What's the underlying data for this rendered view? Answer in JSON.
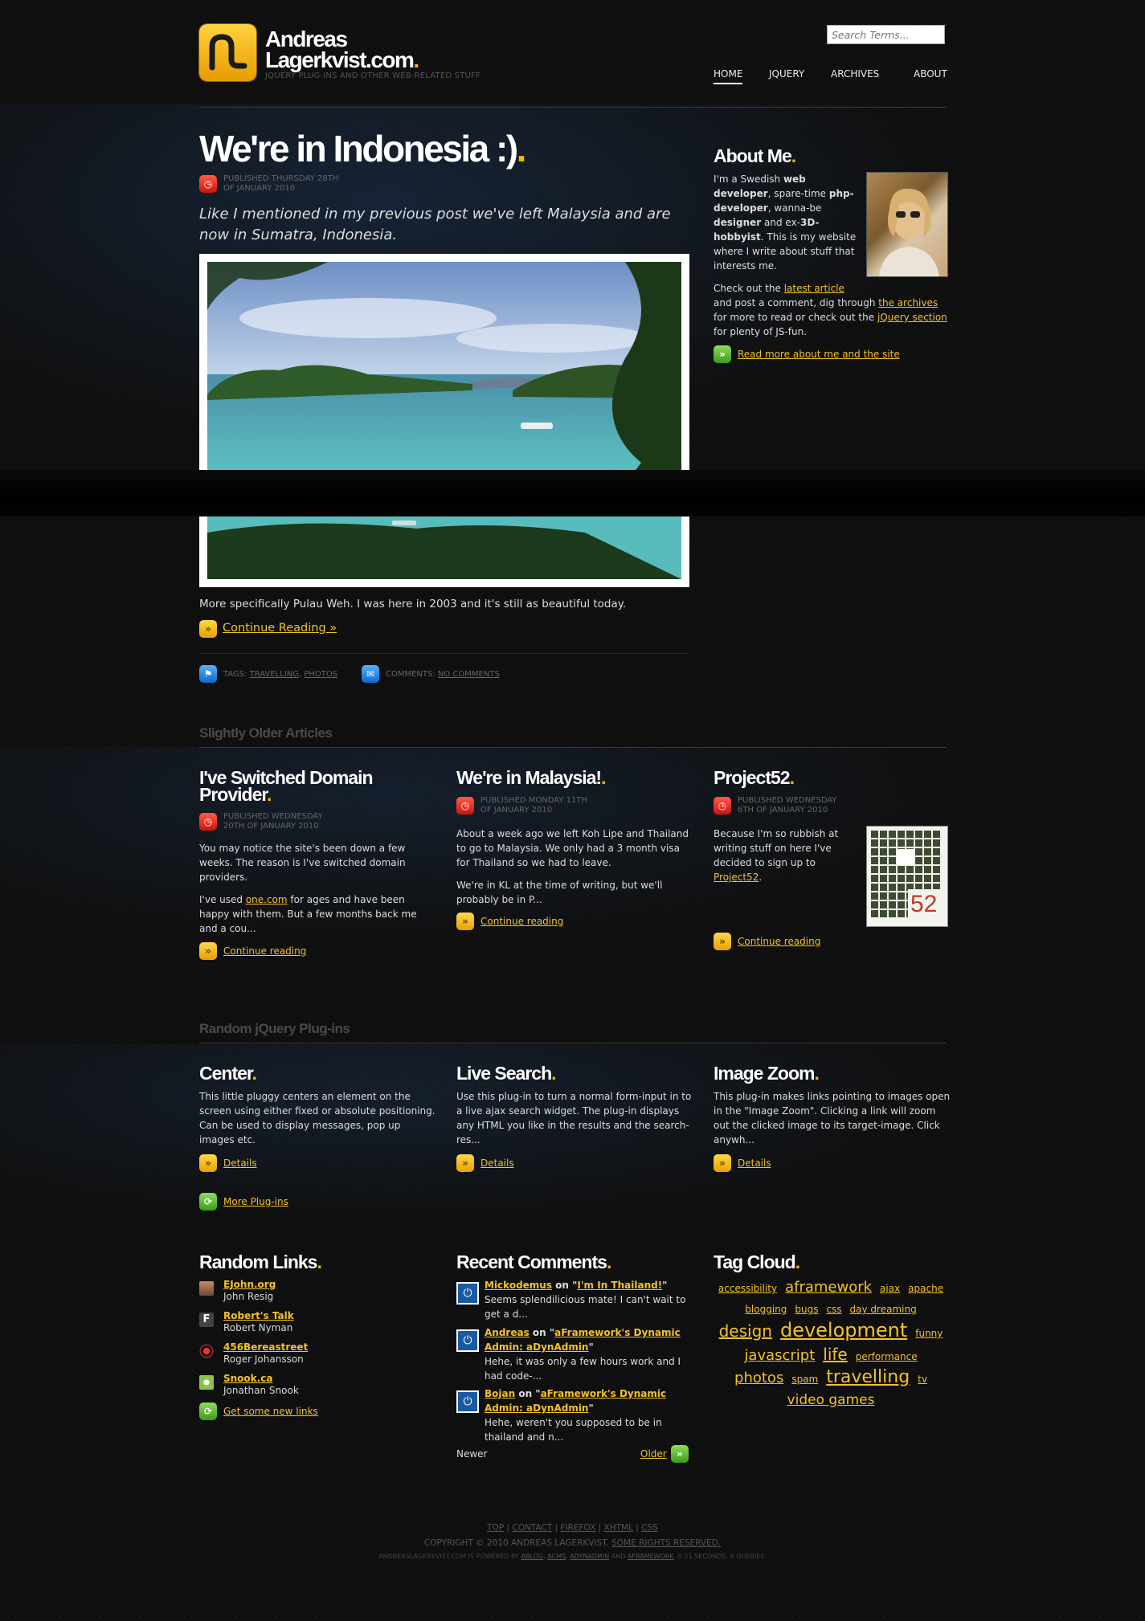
{
  "site": {
    "name_line1": "Andreas",
    "name_line2": "Lagerkvist.com",
    "tagline": "jQuery plug-ins and other web-related stuff",
    "search_placeholder": "Search Terms..."
  },
  "nav": [
    "HOME",
    "JQUERY",
    "ARCHIVES",
    "ABOUT"
  ],
  "post": {
    "title": "We're in Indonesia :)",
    "meta1": "Published Thursday 28th",
    "meta2": "of January 2010",
    "lead": "Like I mentioned in my previous post we've left Malaysia and are now in Sumatra, Indonesia.",
    "body": "More specifically Pulau Weh. I was here in 2003 and it's still as beautiful today.",
    "continue": "Continue Reading »",
    "tags_label": "Tags:",
    "tag1": "Travelling",
    "tag2": "Photos",
    "comments_label": "Comments:",
    "comments_value": "No comments"
  },
  "about": {
    "title": "About Me",
    "p1_a": "I'm a Swedish ",
    "p1_b": "web developer",
    "p1_c": ", spare-time ",
    "p1_d": "php-developer",
    "p1_e": ", wanna-be ",
    "p1_f": "designer",
    "p1_g": " and ex-",
    "p1_h": "3D-hobbyist",
    "p1_i": ". This is my website where I write about stuff that interests me.",
    "p2_a": "Check out the ",
    "p2_link1": "latest article",
    "p2_b": " and post a comment, dig through ",
    "p2_link2": "the archives",
    "p2_c": " for more to read or check out the ",
    "p2_link3": "jQuery section",
    "p2_d": " for plenty of JS-fun.",
    "more": "Read more about me and the site"
  },
  "older": {
    "title": "Slightly Older Articles",
    "a1": {
      "title1": "I've Switched Domain",
      "title2": "Provider",
      "meta1": "Published Wednesday",
      "meta2": "20th of January 2010",
      "p1": "You may notice the site's been down a few weeks. The reason is I've switched domain providers.",
      "p2_a": "I've used ",
      "p2_link": "one.com",
      "p2_b": " for ages and have been happy with them. But a few months back me and a cou...",
      "more": "Continue reading"
    },
    "a2": {
      "title": "We're in Malaysia!",
      "meta1": "Published Monday 11th",
      "meta2": "of January 2010",
      "p1": "About a week ago we left Koh Lipe and Thailand to go to Malaysia. We only had a 3 month visa for Thailand so we had to leave.",
      "p2": "We're in KL at the time of writing, but we'll probably be in P...",
      "more": "Continue reading"
    },
    "a3": {
      "title": "Project52",
      "meta1": "Published Wednesday",
      "meta2": "6th of January 2010",
      "p1": "Because I'm so rubbish at writing stuff on here I've decided to sign up to ",
      "p1_link": "Project52",
      "p1_end": ".",
      "badge": "52",
      "more": "Continue reading"
    }
  },
  "plugins": {
    "title": "Random jQuery Plug-ins",
    "p1": {
      "title": "Center",
      "text": "This little pluggy centers an element on the screen using either fixed or absolute positioning. Can be used to display messages, pop up images etc.",
      "more": "Details"
    },
    "p2": {
      "title": "Live Search",
      "text": "Use this plug-in to turn a normal form-input in to a live ajax search widget. The plug-in displays any HTML you like in the results and the search-res...",
      "more": "Details"
    },
    "p3": {
      "title": "Image Zoom",
      "text": "This plug-in makes links pointing to images open in the \"Image Zoom\". Clicking a link will zoom out the clicked image to its target-image. Click anywh...",
      "more": "Details"
    },
    "all": "More Plug-ins"
  },
  "links": {
    "title": "Random Links",
    "items": [
      {
        "name": "EJohn.org",
        "author": "John Resig"
      },
      {
        "name": "Robert's Talk",
        "author": "Robert Nyman"
      },
      {
        "name": "456Bereastreet",
        "author": "Roger Johansson"
      },
      {
        "name": "Snook.ca",
        "author": "Jonathan Snook"
      }
    ],
    "more": "Get some new links"
  },
  "comments": {
    "title": "Recent Comments",
    "items": [
      {
        "who": "Mickodemus",
        "on": " on \"",
        "post": "I'm In Thailand!",
        "end": "\"",
        "text": "Seems splendilicious mate! I can't wait to get a d..."
      },
      {
        "who": "Andreas",
        "on": " on \"",
        "post": "aFramework's Dynamic Admin: aDynAdmin",
        "end": "\"",
        "text": "Hehe, it was only a few hours work and I had code-..."
      },
      {
        "who": "Bojan",
        "on": " on \"",
        "post": "aFramework's Dynamic Admin: aDynAdmin",
        "end": "\"",
        "text": "Hehe, weren't you supposed to be in thailand and n..."
      }
    ],
    "newer": "Newer",
    "older": "Older"
  },
  "tags": {
    "title": "Tag Cloud",
    "items": [
      {
        "t": "accessibility",
        "s": 12
      },
      {
        "t": "aframework",
        "s": 18
      },
      {
        "t": "ajax",
        "s": 12
      },
      {
        "t": "apache",
        "s": 12
      },
      {
        "t": "blogging",
        "s": 12
      },
      {
        "t": "bugs",
        "s": 12
      },
      {
        "t": "css",
        "s": 12
      },
      {
        "t": "day dreaming",
        "s": 12
      },
      {
        "t": "design",
        "s": 20
      },
      {
        "t": "development",
        "s": 24
      },
      {
        "t": "funny",
        "s": 12
      },
      {
        "t": "javascript",
        "s": 18
      },
      {
        "t": "life",
        "s": 20
      },
      {
        "t": "performance",
        "s": 12
      },
      {
        "t": "photos",
        "s": 18
      },
      {
        "t": "spam",
        "s": 12
      },
      {
        "t": "travelling",
        "s": 22
      },
      {
        "t": "tv",
        "s": 12
      },
      {
        "t": "video games",
        "s": 17
      }
    ]
  },
  "footer": {
    "links": [
      "Top",
      "Contact",
      "Firefox",
      "XHTML",
      "CSS"
    ],
    "copy": "Copyright © 2010 Andreas Lagerkvist.",
    "rights": "Some rights reserved.",
    "powered_a": "AndreasLagerkvist.com is powered by ",
    "p1": "aBlog",
    "p2": "aCMS",
    "p3": "aDynAdmin",
    "and": " and ",
    "p4": "aFramework",
    "stats": ". 0.21 seconds, 9 queries."
  }
}
